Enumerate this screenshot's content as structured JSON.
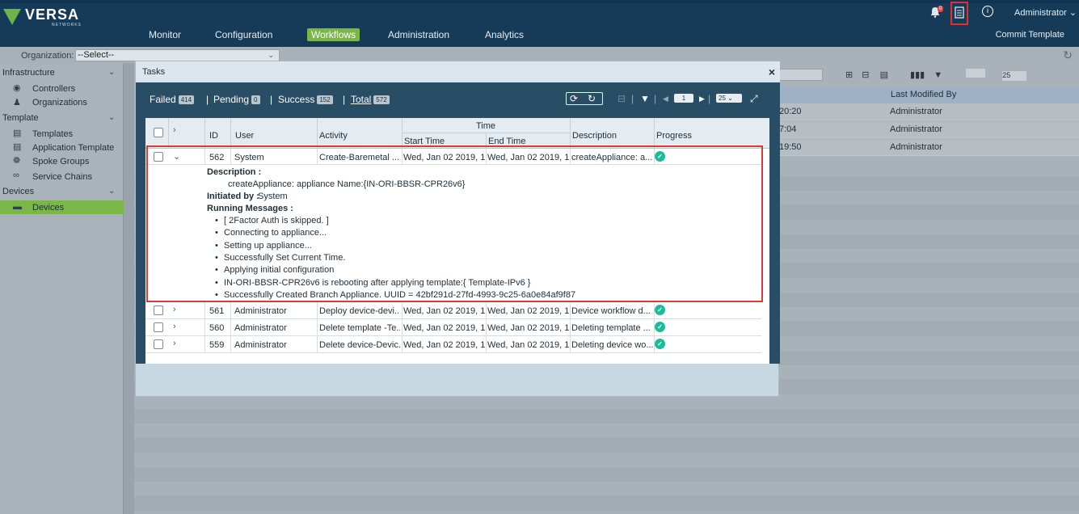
{
  "header": {
    "logo_text": "VERSA",
    "logo_sub": "NETWORKS",
    "nav": [
      "Monitor",
      "Configuration",
      "Workflows",
      "Administration",
      "Analytics"
    ],
    "active_nav": "Workflows",
    "commit_label": "Commit Template",
    "bell_count": "0",
    "user_label": "Administrator"
  },
  "orgbar": {
    "label": "Organization:",
    "select_value": "--Select--"
  },
  "sidebar": {
    "sections": [
      {
        "label": "Infrastructure",
        "items": [
          "Controllers",
          "Organizations"
        ]
      },
      {
        "label": "Template",
        "items": [
          "Templates",
          "Application Template",
          "Spoke Groups",
          "Service Chains"
        ]
      },
      {
        "label": "Devices",
        "items": [
          "Devices"
        ]
      }
    ],
    "active_item": "Devices"
  },
  "background": {
    "last_modified_header": "Last Modified By",
    "rows": [
      {
        "time": "20:20",
        "by": "Administrator"
      },
      {
        "time": "7:04",
        "by": "Administrator"
      },
      {
        "time": "19:50",
        "by": "Administrator"
      }
    ],
    "page_size": "25"
  },
  "modal": {
    "title": "Tasks",
    "close": "×",
    "stats": {
      "failed_label": "Failed",
      "failed_count": "414",
      "pending_label": "Pending",
      "pending_count": "0",
      "success_label": "Success",
      "success_count": "152",
      "total_label": "Total",
      "total_count": "572"
    },
    "page_value": "1",
    "page_size": "25",
    "columns": {
      "id": "ID",
      "user": "User",
      "activity": "Activity",
      "time": "Time",
      "start": "Start Time",
      "end": "End Time",
      "description": "Description",
      "progress": "Progress"
    },
    "expanded_row": {
      "id": "562",
      "user": "System",
      "activity": "Create-Baremetal ...",
      "start": "Wed, Jan 02 2019, 1...",
      "end": "Wed, Jan 02 2019, 1...",
      "description": "createAppliance: a..."
    },
    "detail": {
      "description_label": "Description :",
      "description_value": "createAppliance: appliance Name:{IN-ORI-BBSR-CPR26v6}",
      "initiated_label": "Initiated by :",
      "initiated_value": "System",
      "messages_label": "Running Messages :",
      "messages": [
        "[ 2Factor Auth is skipped. ]",
        "Connecting to appliance...",
        "Setting up appliance...",
        "Successfully Set Current Time.",
        "Applying initial configuration",
        "IN-ORI-BBSR-CPR26v6 is rebooting after applying template:{ Template-IPv6 }",
        "Successfully Created Branch Appliance. UUID = 42bf291d-27fd-4993-9c25-6a0e84af9f87"
      ]
    },
    "rows": [
      {
        "id": "561",
        "user": "Administrator",
        "activity": "Deploy device-devi...",
        "start": "Wed, Jan 02 2019, 1...",
        "end": "Wed, Jan 02 2019, 1...",
        "description": "Device workflow d..."
      },
      {
        "id": "560",
        "user": "Administrator",
        "activity": "Delete template -Te...",
        "start": "Wed, Jan 02 2019, 1...",
        "end": "Wed, Jan 02 2019, 1...",
        "description": "Deleting template ..."
      },
      {
        "id": "559",
        "user": "Administrator",
        "activity": "Delete device-Devic...",
        "start": "Wed, Jan 02 2019, 1...",
        "end": "Wed, Jan 02 2019, 1...",
        "description": "Deleting device wo..."
      }
    ]
  }
}
